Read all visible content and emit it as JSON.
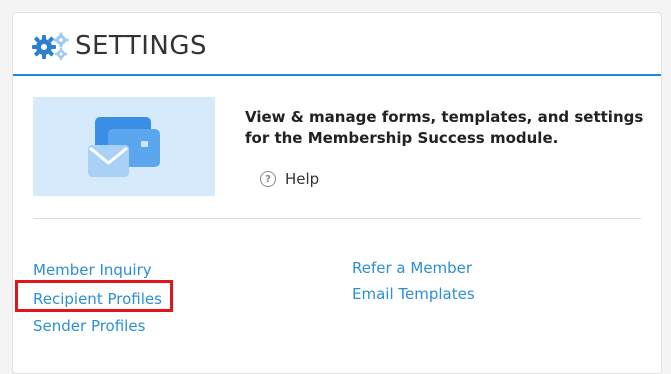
{
  "header": {
    "title": "SETTINGS",
    "icon": "gears-icon",
    "accent_color": "#1e88e5"
  },
  "intro": {
    "description": "View & manage forms, templates, and settings for  the Membership Success module.",
    "illustration_icon": "envelope-cards-icon",
    "help_label": "Help",
    "help_icon": "question-circle-icon"
  },
  "links": {
    "left": [
      "Member Inquiry",
      "Recipient Profiles",
      "Sender Profiles"
    ],
    "right": [
      "Refer a Member",
      "Email Templates"
    ],
    "color": "#2a8fd6",
    "highlighted": "Recipient Profiles",
    "highlight_color": "#e0161e"
  }
}
